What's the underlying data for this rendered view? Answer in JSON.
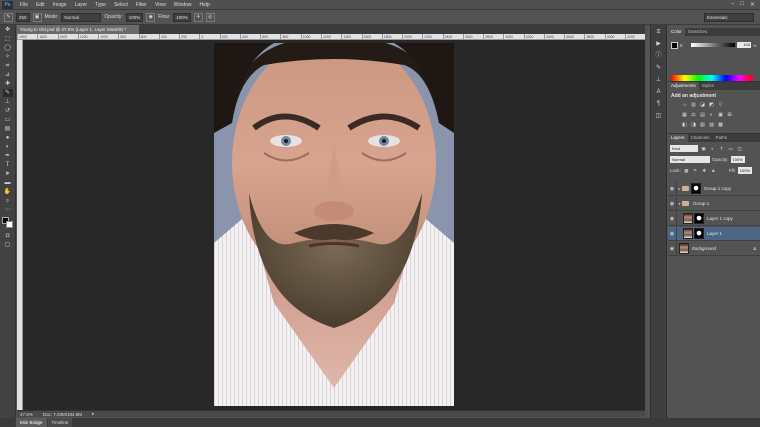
{
  "app": {
    "logo": "Ps"
  },
  "menu": [
    "File",
    "Edit",
    "Image",
    "Layer",
    "Type",
    "Select",
    "Filter",
    "View",
    "Window",
    "Help"
  ],
  "window_controls": [
    "–",
    "□",
    "✕"
  ],
  "options_bar": {
    "brush_size": "250",
    "mode_label": "Mode:",
    "mode_value": "Normal",
    "opacity_label": "Opacity:",
    "opacity_value": "100%",
    "flow_label": "Flow:",
    "flow_value": "100%",
    "workspace": "Essentials"
  },
  "document": {
    "tab_title": "Young to Old.psd @ 47.5% (Layer 1, Layer Mask/8) *",
    "zoom": "47.5%",
    "doc_size": "Doc: 7.03M/184.9M"
  },
  "ruler_ticks": [
    "1800",
    "1600",
    "1400",
    "1200",
    "1000",
    "800",
    "600",
    "400",
    "200",
    "0",
    "200",
    "400",
    "600",
    "800",
    "1000",
    "1200",
    "1400",
    "1600",
    "1800",
    "2000",
    "2200",
    "2400",
    "2600",
    "2800",
    "3000",
    "3200",
    "3400",
    "3600",
    "3800",
    "4000",
    "4200"
  ],
  "bottom_tabs": [
    "Mini Bridge",
    "Timeline"
  ],
  "color_panel": {
    "tabs": [
      "Color",
      "Swatches"
    ],
    "channel": "K",
    "value": "100",
    "unit": "%"
  },
  "adjustments_panel": {
    "tabs": [
      "Adjustments",
      "Styles"
    ],
    "title": "Add an adjustment",
    "row1": [
      "☼",
      "▥",
      "◪",
      "◩",
      "▽"
    ],
    "row2": [
      "▦",
      "⚖",
      "▤",
      "◐",
      "▣",
      "⊞"
    ],
    "row3": [
      "◧",
      "◨",
      "▧",
      "▨",
      "▩"
    ]
  },
  "layers_panel": {
    "tabs": [
      "Layers",
      "Channels",
      "Paths"
    ],
    "filter_kind": "Kind",
    "blend_mode": "Normal",
    "opacity_label": "Opacity:",
    "opacity_value": "100%",
    "lock_label": "Lock:",
    "fill_label": "Fill:",
    "fill_value": "100%",
    "layers": [
      {
        "name": "Group 1 copy"
      },
      {
        "name": "Group 1"
      },
      {
        "name": "Layer 1 copy"
      },
      {
        "name": "Layer 1"
      },
      {
        "name": "Background"
      }
    ]
  },
  "colors": {
    "ui_dark": "#535353",
    "canvas_bg": "#282828",
    "selection": "#4e6686",
    "ps_blue": "#3fa6f1"
  }
}
